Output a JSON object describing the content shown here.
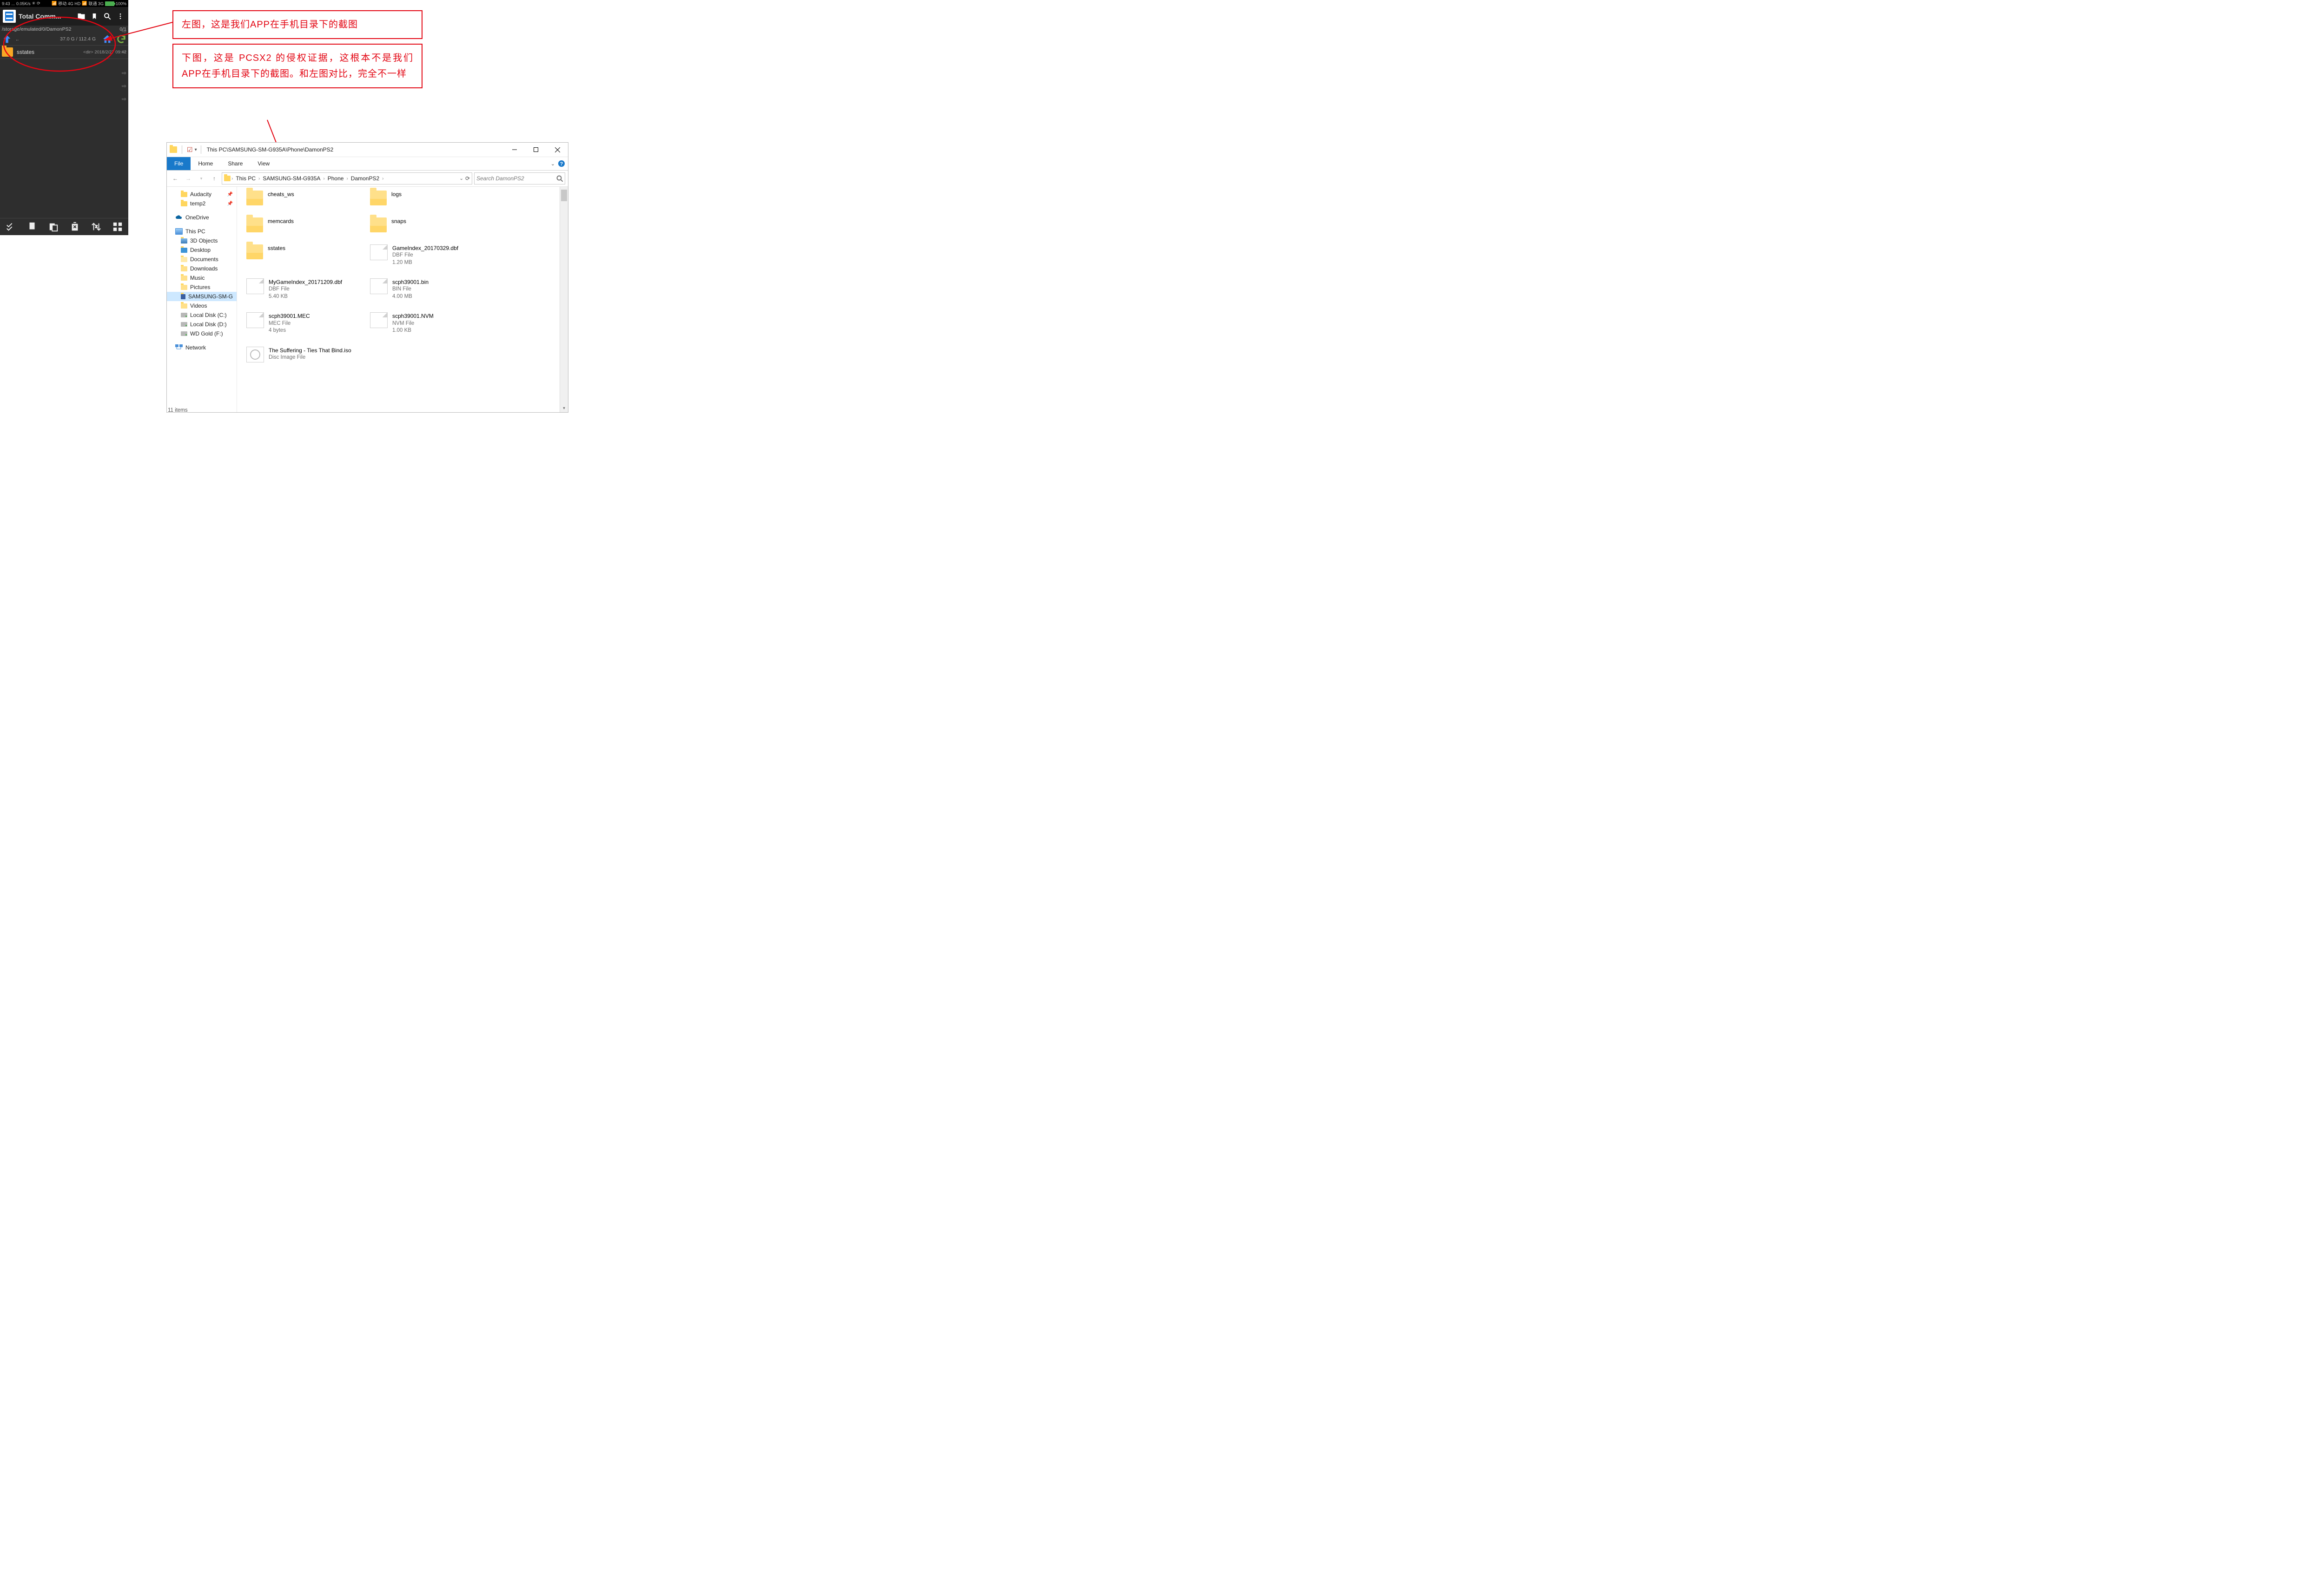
{
  "phone": {
    "status": {
      "time": "9:43",
      "net": "0.05K/s",
      "carrier1": "移动 4G HD",
      "carrier2": "联通 3G",
      "battery": "100%"
    },
    "app_title": "Total Comm...",
    "path": "/storage/emulated/0/DamonPS2",
    "count": "0/1",
    "up_label": "..",
    "storage": "37.0 G / 112.4 G",
    "file": {
      "name": "sstates",
      "meta": "<dir>  2018/2/27  09:42"
    }
  },
  "anno1": "左图，这是我们APP在手机目录下的截图",
  "anno2": "下图，这是 PCSX2 的侵权证据，这根本不是我们APP在手机目录下的截图。和左图对比，完全不一样",
  "explorer": {
    "titlebar_path": "This PC\\SAMSUNG-SM-G935A\\Phone\\DamonPS2",
    "tabs": {
      "file": "File",
      "home": "Home",
      "share": "Share",
      "view": "View"
    },
    "breadcrumb": [
      "This PC",
      "SAMSUNG-SM-G935A",
      "Phone",
      "DamonPS2"
    ],
    "search_placeholder": "Search DamonPS2",
    "nav": {
      "quick": [
        {
          "label": "Audacity",
          "pin": true
        },
        {
          "label": "temp2",
          "pin": true
        }
      ],
      "onedrive": "OneDrive",
      "thispc": "This PC",
      "children": [
        {
          "label": "3D Objects"
        },
        {
          "label": "Desktop"
        },
        {
          "label": "Documents"
        },
        {
          "label": "Downloads"
        },
        {
          "label": "Music"
        },
        {
          "label": "Pictures"
        },
        {
          "label": "SAMSUNG-SM-G",
          "selected": true
        },
        {
          "label": "Videos"
        },
        {
          "label": "Local Disk (C:)"
        },
        {
          "label": "Local Disk (D:)"
        },
        {
          "label": "WD Gold (F:)"
        }
      ],
      "network": "Network"
    },
    "items": [
      {
        "name": "cheats_ws",
        "type": "folder"
      },
      {
        "name": "logs",
        "type": "folder"
      },
      {
        "name": "memcards",
        "type": "folder"
      },
      {
        "name": "snaps",
        "type": "folder"
      },
      {
        "name": "sstates",
        "type": "folder"
      },
      {
        "name": "GameIndex_20170329.dbf",
        "type": "file",
        "sub1": "DBF File",
        "sub2": "1.20 MB"
      },
      {
        "name": "MyGameIndex_20171209.dbf",
        "type": "file",
        "sub1": "DBF File",
        "sub2": "5.40 KB"
      },
      {
        "name": "scph39001.bin",
        "type": "file",
        "sub1": "BIN File",
        "sub2": "4.00 MB"
      },
      {
        "name": "scph39001.MEC",
        "type": "file",
        "sub1": "MEC File",
        "sub2": "4 bytes"
      },
      {
        "name": "scph39001.NVM",
        "type": "file",
        "sub1": "NVM File",
        "sub2": "1.00 KB"
      },
      {
        "name": "The Suffering - Ties That Bind.iso",
        "type": "iso",
        "sub1": "Disc Image File"
      }
    ],
    "status": "11 items"
  }
}
